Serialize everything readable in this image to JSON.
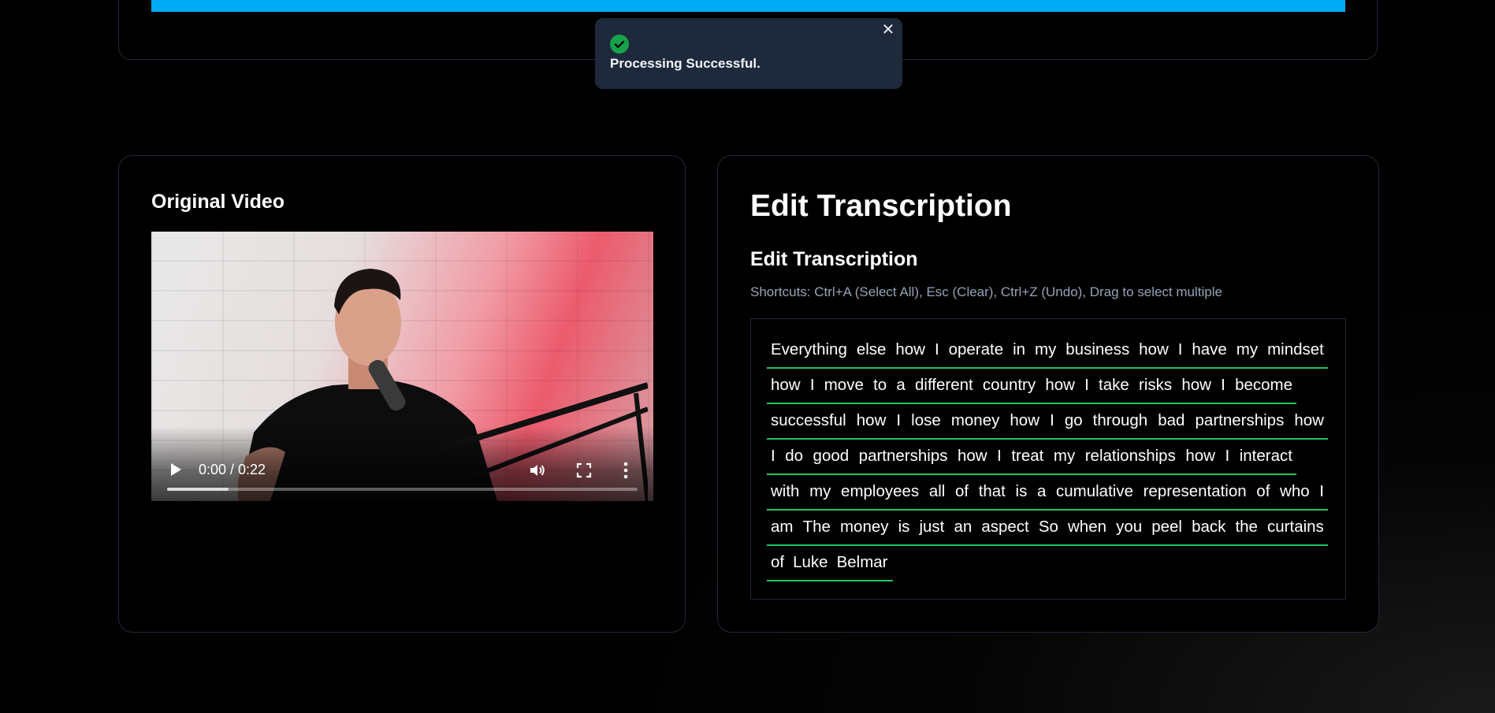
{
  "toast": {
    "message": "Processing Successful.",
    "close_glyph": "✕",
    "icon": "check-circle-icon",
    "icon_color": "#16a34a"
  },
  "top_progress": {
    "color": "#00aaf5",
    "progress": 1.0
  },
  "video_card": {
    "title": "Original Video",
    "player": {
      "time": "0:00 / 0:22",
      "progress": 0.0,
      "buffered": 0.13,
      "icons": [
        "play-icon",
        "volume-icon",
        "fullscreen-icon",
        "more-options-icon"
      ]
    }
  },
  "transcript_card": {
    "heading": "Edit Transcription",
    "subheading": "Edit Transcription",
    "shortcuts": "Shortcuts: Ctrl+A (Select All), Esc (Clear), Ctrl+Z (Undo), Drag to select multiple",
    "underline_color": "#22c55e",
    "lines": [
      [
        "Everything",
        "else",
        "how",
        "I",
        "operate",
        "in",
        "my",
        "business",
        "how",
        "I",
        "have",
        "my",
        "mindset"
      ],
      [
        "how",
        "I",
        "move",
        "to",
        "a",
        "different",
        "country",
        "how",
        "I",
        "take",
        "risks",
        "how",
        "I",
        "become"
      ],
      [
        "successful",
        "how",
        "I",
        "lose",
        "money",
        "how",
        "I",
        "go",
        "through",
        "bad",
        "partnerships",
        "how"
      ],
      [
        "I",
        "do",
        "good",
        "partnerships",
        "how",
        "I",
        "treat",
        "my",
        "relationships",
        "how",
        "I",
        "interact"
      ],
      [
        "with",
        "my",
        "employees",
        "all",
        "of",
        "that",
        "is",
        "a",
        "cumulative",
        "representation",
        "of",
        "who",
        "I"
      ],
      [
        "am",
        "The",
        "money",
        "is",
        "just",
        "an",
        "aspect",
        "So",
        "when",
        "you",
        "peel",
        "back",
        "the",
        "curtains"
      ],
      [
        "of",
        "Luke",
        "Belmar"
      ]
    ]
  }
}
